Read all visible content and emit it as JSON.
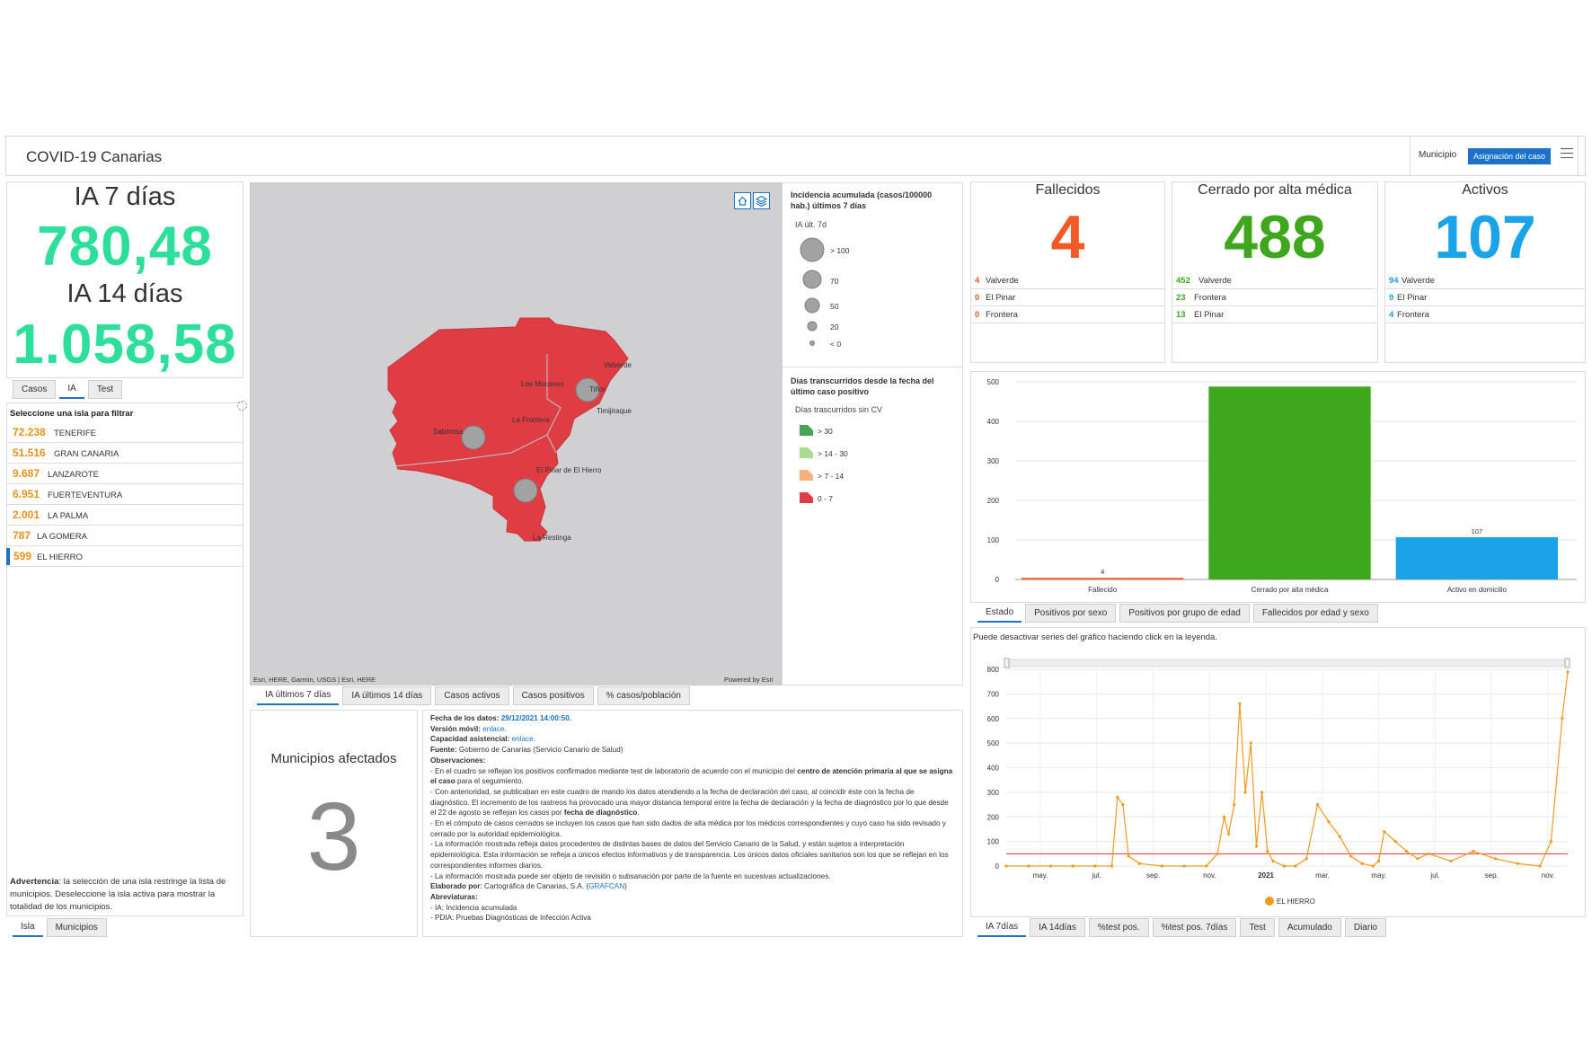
{
  "header": {
    "title": "COVID-19 Canarias",
    "municipio_label": "Municipio",
    "asignacion_label": "Asignación del caso"
  },
  "ia_panel": {
    "ia7_label": "IA 7 días",
    "ia7_value": "780,48",
    "ia14_label": "IA 14 días",
    "ia14_value": "1.058,58",
    "tabs": [
      "Casos",
      "IA",
      "Test"
    ],
    "active_tab": "IA",
    "accent": "#2ddf9a"
  },
  "islands": {
    "title": "Seleccione una isla para filtrar",
    "items": [
      {
        "value": "72.238",
        "name": "TENERIFE"
      },
      {
        "value": "51.516",
        "name": "GRAN CANARIA"
      },
      {
        "value": "9.687",
        "name": "LANZAROTE"
      },
      {
        "value": "6.951",
        "name": "FUERTEVENTURA"
      },
      {
        "value": "2.001",
        "name": "LA PALMA"
      },
      {
        "value": "787",
        "name": "LA GOMERA"
      },
      {
        "value": "599",
        "name": "EL HIERRO"
      }
    ],
    "selected": "EL HIERRO",
    "warning_bold": "Advertencia",
    "warning_text": ": la selección de una isla restringe la lista de municipios. Deseleccione la isla activa para mostrar la totalidad de los municipios.",
    "tabs": [
      "Isla",
      "Municipios"
    ],
    "active_tab": "Isla"
  },
  "map": {
    "place_labels": [
      "Valverde",
      "Los Mocanes",
      "Tiñor",
      "Timijiraque",
      "La Frontera",
      "Sabinosa",
      "El Pinar de El Hierro",
      "La Restinga"
    ],
    "attribution_left": "Esri, HERE, Garmin, USGS | Esri, HERE",
    "attribution_right": "Powered by Esri",
    "home_icon": "home-icon",
    "layers_icon": "layers-icon",
    "tabs": [
      "IA últimos 7 días",
      "IA últimos 14 días",
      "Casos activos",
      "Casos positivos",
      "% casos/población"
    ],
    "active_tab": "IA últimos 7 días",
    "fill_color": "#e03c43"
  },
  "legend": {
    "ia_title": "Incidencia acumulada (casos/100000 hab.) últimos 7 días",
    "ia_sub": "IA últ. 7d",
    "ia_items": [
      "> 100",
      "70",
      "50",
      "20",
      "< 0"
    ],
    "dias_title": "Días transcurridos desde la fecha del último caso positivo",
    "dias_sub": "Días trascurridos sin CV",
    "dias_items": [
      {
        "label": "> 30",
        "color": "#4aa35a"
      },
      {
        "label": "> 14 - 30",
        "color": "#a9dc8e"
      },
      {
        "label": "> 7 - 14",
        "color": "#f4b27a"
      },
      {
        "label": "0 - 7",
        "color": "#e03c43"
      }
    ]
  },
  "municipios": {
    "title": "Municipios afectados",
    "value": "3"
  },
  "info": {
    "fecha_label": "Fecha de los datos:",
    "fecha_value": "29/12/2021 14:00:50.",
    "version_label": "Versión móvil:",
    "version_link": "enlace.",
    "capacidad_label": "Capacidad asistencial:",
    "capacidad_link": "enlace.",
    "fuente_label": "Fuente:",
    "fuente_text": "Gobierno de Canarias (Servicio Canario de Salud)",
    "obs_label": "Observaciones:",
    "obs1a": "- En el cuadro se reflejan los positivos confirmados mediante test de laboratorio de acuerdo con el municipio del ",
    "obs1b": "centro de atención primaria al que se asigna el caso",
    "obs1c": " para el seguimiento.",
    "obs2": "- Con anterioridad, se publicaban en este cuadro de mando los datos atendiendo a la fecha de declaración del caso, al coincidir éste con la fecha de diagnóstico. El incremento de los rastreos ha provocado una mayor distancia temporal entre la fecha de declaración y la fecha de diagnóstico por lo que desde el 22 de agosto se reflejan los casos por ",
    "obs2b": "fecha de diagnóstico",
    "obs3": "- En el cómputo de casos cerrados se incluyen los casos que han sido dados de alta médica por los médicos correspondientes y cuyo caso ha sido revisado y cerrado por la autoridad epidemiológica.",
    "obs4": "- La información mostrada refleja datos procedentes de distintas bases de datos del Servicio Canario de la Salud, y están sujetos a interpretación epidemiológica. Esta información se refleja a únicos efectos informativos y de transparencia. Los únicos datos oficiales sanitarios son los que se reflejan en los correspondientes informes diarios.",
    "obs5": "- La información mostrada puede ser objeto de revisión o subsanación por parte de la fuente en sucesivas actualizaciones.",
    "elab_label": "Elaborado por",
    "elab_text": ": Cartográfica de Canarias, S.A. (",
    "elab_link": "GRAFCAN",
    "abrev_label": "Abreviaturas:",
    "abrev1": "- IA: Incidencia acumulada",
    "abrev2": "- PDIA: Pruebas Diagnósticas de Infección Activa"
  },
  "kpis": [
    {
      "title": "Fallecidos",
      "value": "4",
      "color": "#f15a24",
      "rows": [
        {
          "v": "4",
          "n": "Valverde"
        },
        {
          "v": "0",
          "n": "El Pinar"
        },
        {
          "v": "0",
          "n": "Frontera"
        }
      ]
    },
    {
      "title": "Cerrado por alta médica",
      "value": "488",
      "color": "#3fa71e",
      "rows": [
        {
          "v": "452",
          "n": "Valverde"
        },
        {
          "v": "23",
          "n": "Frontera"
        },
        {
          "v": "13",
          "n": "El Pinar"
        }
      ]
    },
    {
      "title": "Activos",
      "value": "107",
      "color": "#1aa3e8",
      "rows": [
        {
          "v": "94",
          "n": "Valverde"
        },
        {
          "v": "9",
          "n": "El Pinar"
        },
        {
          "v": "4",
          "n": "Frontera"
        }
      ]
    }
  ],
  "estado_tabs": [
    "Estado",
    "Positivos por sexo",
    "Positivos por grupo de edad",
    "Fallecidos por edad y sexo"
  ],
  "estado_active": "Estado",
  "series_tabs": [
    "IA 7días",
    "IA 14días",
    "%test pos.",
    "%test pos. 7días",
    "Test",
    "Acumulado",
    "Diario"
  ],
  "series_active": "IA 7días",
  "line_note": "Puede desactivar series del gráfico haciendo click en la leyenda.",
  "chart_data": [
    {
      "type": "bar",
      "categories": [
        "Fallecido",
        "Cerrado por alta médica",
        "Activo en domicilio"
      ],
      "values": [
        4,
        488,
        107
      ],
      "colors": [
        "#f15a24",
        "#3fa71e",
        "#1aa3e8"
      ],
      "ylim": [
        0,
        500
      ],
      "yticks": [
        0,
        100,
        200,
        300,
        400,
        500
      ],
      "data_labels": [
        "4",
        "",
        "107"
      ]
    },
    {
      "type": "line",
      "series": [
        {
          "name": "EL HIERRO",
          "color": "#f29a1d"
        }
      ],
      "x_ticks": [
        "may.",
        "jul.",
        "sep.",
        "nov.",
        "2021",
        "mar.",
        "may.",
        "jul.",
        "sep.",
        "nov."
      ],
      "yticks": [
        0,
        100,
        200,
        300,
        400,
        500,
        600,
        700,
        800
      ],
      "ylim": [
        0,
        800
      ],
      "reference_line": 50,
      "reference_color": "#e8323c",
      "x": [
        0,
        2,
        4,
        6,
        8,
        9.5,
        10,
        10.5,
        11,
        12,
        14,
        16,
        18,
        19,
        19.6,
        20,
        20.5,
        21,
        21.5,
        22,
        22.5,
        23,
        23.5,
        24,
        25,
        26,
        27,
        28,
        29,
        30,
        31,
        32,
        33,
        33.5,
        34,
        35,
        36,
        37,
        38,
        40,
        42,
        44,
        46,
        48,
        49,
        50,
        50.5
      ],
      "values": [
        0,
        0,
        0,
        0,
        0,
        0,
        280,
        250,
        40,
        10,
        0,
        0,
        0,
        50,
        200,
        130,
        250,
        660,
        300,
        500,
        80,
        300,
        60,
        20,
        0,
        0,
        30,
        250,
        180,
        120,
        40,
        10,
        0,
        20,
        140,
        100,
        60,
        30,
        50,
        20,
        60,
        30,
        10,
        0,
        100,
        600,
        790
      ]
    }
  ]
}
